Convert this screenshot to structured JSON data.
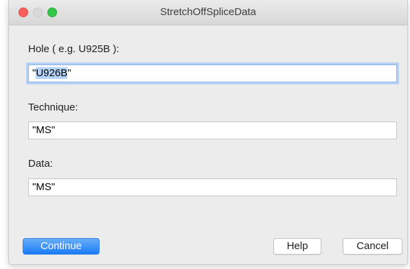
{
  "window": {
    "title": "StretchOffSpliceData"
  },
  "form": {
    "hole": {
      "label": "Hole ( e.g. U925B ):",
      "value_prefix": "\"",
      "value_selected": "U926B",
      "value_suffix": "\""
    },
    "technique": {
      "label": "Technique:",
      "value": "\"MS\""
    },
    "data": {
      "label": "Data:",
      "value": "\"MS\""
    }
  },
  "buttons": {
    "continue_label": "Continue",
    "help_label": "Help",
    "cancel_label": "Cancel"
  },
  "colors": {
    "accent": "#1a7bf6",
    "focus_ring": "#b6d1f4",
    "selection": "#b4d4fc"
  }
}
